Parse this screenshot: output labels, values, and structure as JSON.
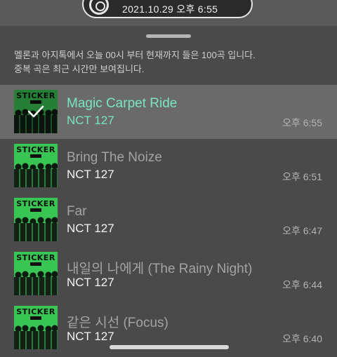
{
  "status_pill": {
    "datetime": "2021.10.29 오후 6:55"
  },
  "notice": {
    "line1": "멜론과 아지톡에서 오늘 00시 부터 현재까지 들은 100곡 입니다.",
    "line2": "중복 곡은 최근 시간만 보여집니다."
  },
  "songs": [
    {
      "title": "Magic Carpet Ride",
      "artist": "NCT 127",
      "time": "오후 6:55",
      "selected": true,
      "album_text": "STICKER"
    },
    {
      "title": "Bring The Noize",
      "artist": "NCT 127",
      "time": "오후 6:51",
      "selected": false,
      "album_text": "STICKER"
    },
    {
      "title": "Far",
      "artist": "NCT 127",
      "time": "오후 6:47",
      "selected": false,
      "album_text": "STICKER"
    },
    {
      "title": "내일의 나에게 (The Rainy Night)",
      "artist": "NCT 127",
      "time": "오후 6:44",
      "selected": false,
      "album_text": "STICKER"
    },
    {
      "title": "같은 시선 (Focus)",
      "artist": "NCT 127",
      "time": "오후 6:40",
      "selected": false,
      "album_text": "STICKER"
    }
  ],
  "colors": {
    "accent": "#79e6bf",
    "background": "#4a4a4a",
    "selected_row": "#6a6a6a",
    "album_green": "#39c553"
  },
  "icons": {
    "now_playing": "disc-icon",
    "selected_check": "check-icon"
  }
}
